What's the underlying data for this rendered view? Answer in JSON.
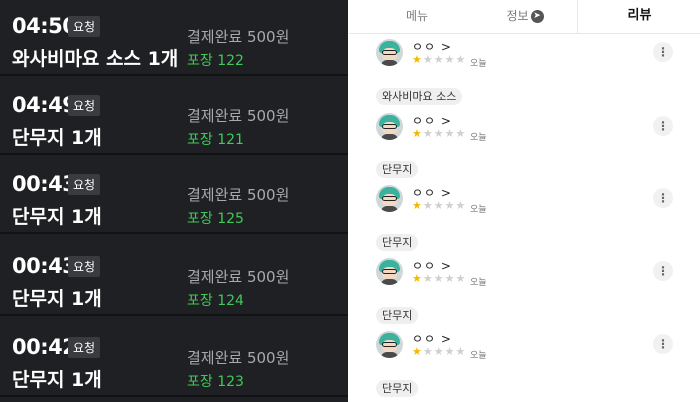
{
  "orders": [
    {
      "time": "04:50",
      "tag": "요청",
      "item": "와사비마요 소스 1개",
      "status": "결제완료 500원",
      "pack": "포장 122"
    },
    {
      "time": "04:49",
      "tag": "요청",
      "item": "단무지 1개",
      "status": "결제완료 500원",
      "pack": "포장 121"
    },
    {
      "time": "00:43",
      "tag": "요청",
      "item": "단무지 1개",
      "status": "결제완료 500원",
      "pack": "포장 125"
    },
    {
      "time": "00:43",
      "tag": "요청",
      "item": "단무지 1개",
      "status": "결제완료 500원",
      "pack": "포장 124"
    },
    {
      "time": "00:42",
      "tag": "요청",
      "item": "단무지 1개",
      "status": "결제완료 500원",
      "pack": "포장 123"
    }
  ],
  "tabs": {
    "menu": "메뉴",
    "info": "정보",
    "review": "리뷰",
    "info_icon": "send-icon"
  },
  "reviews": [
    {
      "chip": "",
      "name": "ㅇㅇ >",
      "rating": 1,
      "stars_on": "★",
      "stars_off": "★★★★",
      "date": "오늘"
    },
    {
      "chip": "와사비마요 소스",
      "name": "ㅇㅇ >",
      "rating": 1,
      "stars_on": "★",
      "stars_off": "★★★★",
      "date": "오늘"
    },
    {
      "chip": "단무지",
      "name": "ㅇㅇ >",
      "rating": 1,
      "stars_on": "★",
      "stars_off": "★★★★",
      "date": "오늘"
    },
    {
      "chip": "단무지",
      "name": "ㅇㅇ >",
      "rating": 1,
      "stars_on": "★",
      "stars_off": "★★★★",
      "date": "오늘"
    },
    {
      "chip": "단무지",
      "name": "ㅇㅇ >",
      "rating": 1,
      "stars_on": "★",
      "stars_off": "★★★★",
      "date": "오늘"
    },
    {
      "chip": "단무지",
      "name": "",
      "rating": null,
      "stars_on": "",
      "stars_off": "",
      "date": ""
    }
  ],
  "more_label": "⋮"
}
